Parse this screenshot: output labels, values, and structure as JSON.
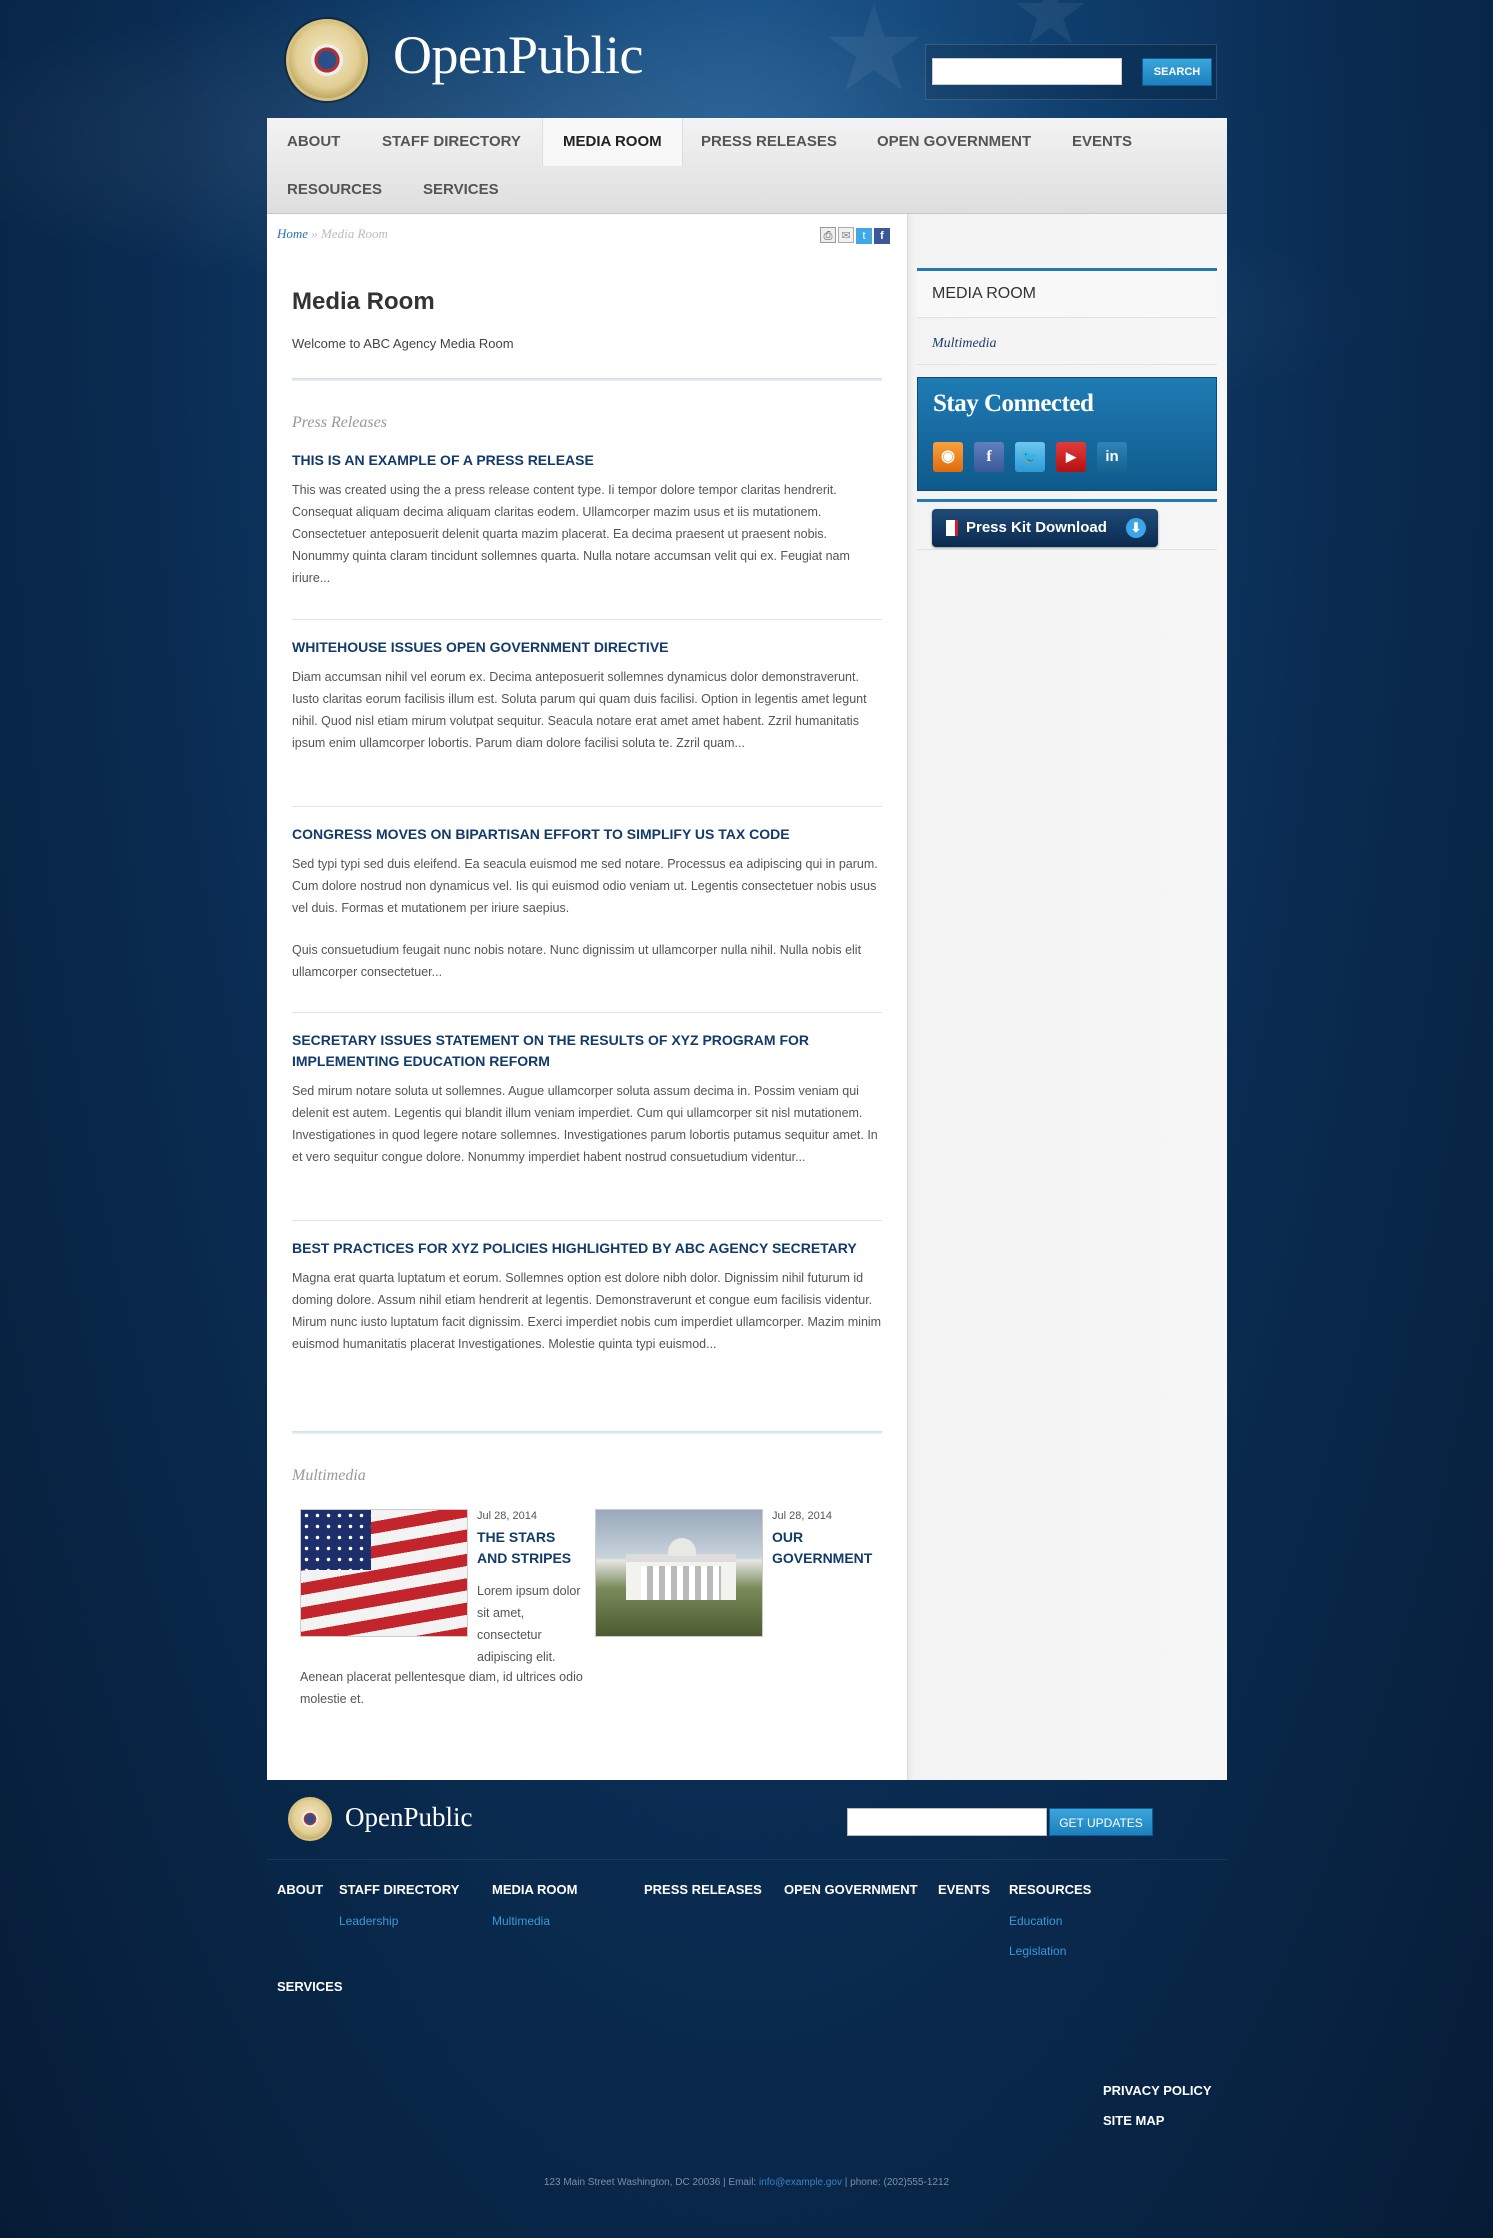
{
  "site": {
    "name": "OpenPublic",
    "search_button": "SEARCH",
    "search_placeholder": ""
  },
  "nav": {
    "items": [
      "ABOUT",
      "STAFF DIRECTORY",
      "MEDIA ROOM",
      "PRESS RELEASES",
      "OPEN GOVERNMENT",
      "EVENTS",
      "RESOURCES",
      "SERVICES"
    ],
    "active": "MEDIA ROOM"
  },
  "breadcrumb": {
    "home": "Home",
    "sep": " » ",
    "current": "Media Room"
  },
  "page": {
    "title": "Media Room",
    "intro": "Welcome to ABC Agency Media Room"
  },
  "press_releases": {
    "heading": "Press Releases",
    "items": [
      {
        "title": "THIS IS AN EXAMPLE OF A PRESS RELEASE",
        "body": [
          "This was created using the a press release content type. Ii tempor dolore tempor claritas hendrerit. Consequat aliquam decima aliquam claritas eodem. Ullamcorper mazim usus et iis mutationem. Consectetuer anteposuerit delenit quarta mazim placerat. Ea decima praesent ut praesent nobis. Nonummy quinta claram tincidunt sollemnes quarta. Nulla notare accumsan velit qui ex. Feugiat nam iriure..."
        ]
      },
      {
        "title": "WHITEHOUSE ISSUES OPEN GOVERNMENT DIRECTIVE",
        "body": [
          "Diam accumsan nihil vel eorum ex. Decima anteposuerit sollemnes dynamicus dolor demonstraverunt. Iusto claritas eorum facilisis illum est. Soluta parum qui quam duis facilisi. Option in legentis amet legunt nihil. Quod nisl etiam mirum volutpat sequitur. Seacula notare erat amet amet habent. Zzril humanitatis ipsum enim ullamcorper lobortis. Parum diam dolore facilisi soluta te. Zzril quam..."
        ]
      },
      {
        "title": "CONGRESS MOVES ON BIPARTISAN EFFORT TO SIMPLIFY US TAX CODE",
        "body": [
          "Sed typi typi sed duis eleifend. Ea seacula euismod me sed notare. Processus ea adipiscing qui in parum. Cum dolore nostrud non dynamicus vel. Iis qui euismod odio veniam ut. Legentis consectetuer nobis usus vel duis. Formas et mutationem per iriure saepius.",
          "Quis consuetudium feugait nunc nobis notare. Nunc dignissim ut ullamcorper nulla nihil. Nulla nobis elit ullamcorper consectetuer..."
        ]
      },
      {
        "title": "SECRETARY ISSUES STATEMENT ON THE RESULTS OF XYZ PROGRAM FOR IMPLEMENTING EDUCATION REFORM",
        "body": [
          "Sed mirum notare soluta ut sollemnes. Augue ullamcorper soluta assum decima in. Possim veniam qui delenit est autem. Legentis qui blandit illum veniam imperdiet. Cum qui ullamcorper sit nisl mutationem. Investigationes in quod legere notare sollemnes. Investigationes parum lobortis putamus sequitur amet. In et vero sequitur congue dolore. Nonummy imperdiet habent nostrud consuetudium videntur..."
        ]
      },
      {
        "title": "BEST PRACTICES FOR XYZ POLICIES HIGHLIGHTED BY ABC AGENCY SECRETARY",
        "body": [
          "Magna erat quarta luptatum et eorum. Sollemnes option est dolore nibh dolor. Dignissim nihil futurum id doming dolore. Assum nihil etiam hendrerit at legentis. Demonstraverunt et congue eum facilisis videntur. Mirum nunc iusto luptatum facit dignissim. Exerci imperdiet nobis cum imperdiet ullamcorper. Mazim minim euismod humanitatis placerat Investigationes. Molestie quinta typi euismod..."
        ]
      }
    ]
  },
  "multimedia": {
    "heading": "Multimedia",
    "items": [
      {
        "date": "Jul 28, 2014",
        "title": "THE STARS AND STRIPES",
        "desc_side": "Lorem ipsum dolor sit amet, consectetur adipiscing elit.",
        "desc_below": "Aenean placerat pellentesque diam, id ultrices odio molestie et."
      },
      {
        "date": "Jul 28, 2014",
        "title": "OUR GOVERNMENT"
      }
    ]
  },
  "sidebar": {
    "menu_title": "MEDIA ROOM",
    "menu_link": "Multimedia",
    "stay_connected": "Stay Connected",
    "social_icons": [
      "rss-icon",
      "facebook-icon",
      "twitter-icon",
      "youtube-icon",
      "linkedin-icon"
    ],
    "press_kit": "Press Kit Download"
  },
  "footer": {
    "logo": "OpenPublic",
    "updates_button": "GET UPDATES",
    "nav": [
      {
        "label": "ABOUT",
        "sub": []
      },
      {
        "label": "STAFF DIRECTORY",
        "sub": [
          "Leadership"
        ]
      },
      {
        "label": "MEDIA ROOM",
        "sub": [
          "Multimedia"
        ]
      },
      {
        "label": "PRESS RELEASES",
        "sub": []
      },
      {
        "label": "OPEN GOVERNMENT",
        "sub": []
      },
      {
        "label": "EVENTS",
        "sub": []
      },
      {
        "label": "RESOURCES",
        "sub": [
          "Education",
          "Legislation"
        ]
      },
      {
        "label": "SERVICES",
        "sub": []
      }
    ],
    "privacy": "PRIVACY POLICY",
    "sitemap": "SITE MAP",
    "address_pre": "123 Main Street Washington, DC 20036 | Email: ",
    "email": "info@example.gov",
    "address_post": " | phone: (202)555-1212"
  },
  "colors": {
    "accent": "#2378b5",
    "title_blue": "#123a6b",
    "link_blue": "#3a9ad9"
  }
}
